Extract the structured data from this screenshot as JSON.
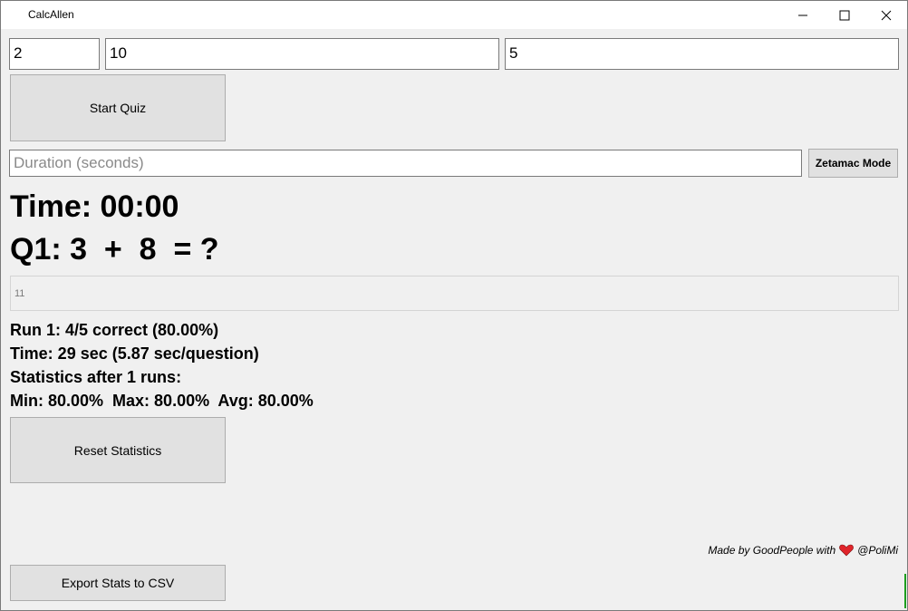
{
  "window": {
    "title": "CalcAllen",
    "minimize_glyph": "—",
    "maximize_glyph": "☐",
    "close_glyph": "✕"
  },
  "inputs": {
    "operands": "2",
    "max_value": "10",
    "question_count": "5",
    "duration_placeholder": "Duration (seconds)",
    "answer": "11"
  },
  "buttons": {
    "start_quiz": "Start Quiz",
    "zetamac_mode": "Zetamac Mode",
    "reset_statistics": "Reset Statistics",
    "export_csv": "Export Stats to CSV"
  },
  "quiz": {
    "timer": "Time: 00:00",
    "question": "Q1: 3  +  8  = ?"
  },
  "stats": {
    "run_result": "Run 1: 4/5 correct (80.00%)",
    "time_result": "Time: 29 sec (5.87 sec/question)",
    "stats_header": "Statistics after 1 runs:",
    "min_max_avg": "Min: 80.00%  Max: 80.00%  Avg: 80.00%"
  },
  "footer": {
    "made_by": "Made by GoodPeople with",
    "heart_icon": "heart-icon",
    "org": "@PoliMi",
    "heart_color": "#e0242a"
  }
}
